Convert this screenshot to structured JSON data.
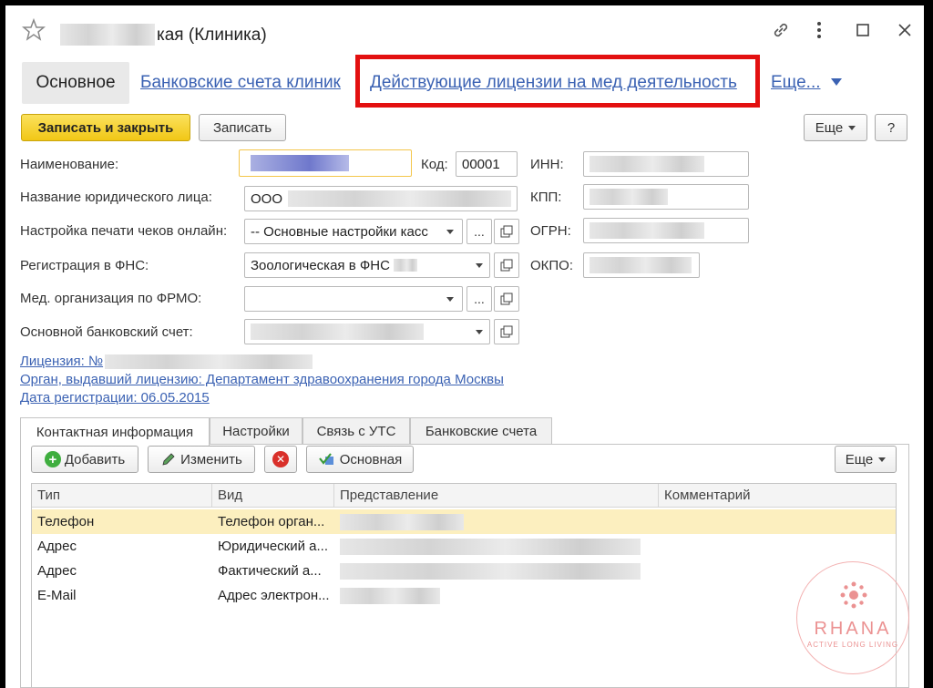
{
  "window": {
    "title_suffix": "кая (Клиника)"
  },
  "nav": {
    "active": "Основное",
    "link1": "Банковские счета клиник",
    "link2": "Действующие лицензии на мед деятельность",
    "more": "Еще..."
  },
  "toolbar": {
    "save_close": "Записать и закрыть",
    "save": "Записать",
    "more": "Еще",
    "help": "?"
  },
  "form": {
    "name_label": "Наименование:",
    "legal_label": "Название юридического лица:",
    "legal_value": "ООО",
    "print_label": "Настройка печати чеков онлайн:",
    "print_value": "-- Основные настройки касс",
    "fns_label": "Регистрация в ФНС:",
    "fns_value": "Зоологическая в ФНС",
    "frmo_label": "Мед. организация по ФРМО:",
    "bank_label": "Основной банковский счет:",
    "code_label": "Код:",
    "code_value": "00001",
    "inn_label": "ИНН:",
    "kpp_label": "КПП:",
    "ogrn_label": "ОГРН:",
    "okpo_label": "ОКПО:",
    "ellipsis": "...",
    "open_icon": "open-icon"
  },
  "license": {
    "line1": "Лицензия: №",
    "line2": "Орган, выдавший лицензию:  Департамент здравоохранения города Москвы",
    "line3": "Дата регистрации: 06.05.2015"
  },
  "tabs": [
    "Контактная информация",
    "Настройки",
    "Связь с УТС",
    "Банковские счета"
  ],
  "contacts_toolbar": {
    "add": "Добавить",
    "edit": "Изменить",
    "main": "Основная",
    "more": "Еще"
  },
  "table": {
    "headers": [
      "Тип",
      "Вид",
      "Представление",
      "Комментарий"
    ],
    "rows": [
      {
        "type": "Телефон",
        "kind": "Телефон орган..."
      },
      {
        "type": "Адрес",
        "kind": "Юридический а..."
      },
      {
        "type": "Адрес",
        "kind": "Фактический а..."
      },
      {
        "type": "E-Mail",
        "kind": "Адрес электрон..."
      }
    ]
  },
  "watermark": {
    "brand": "RHANA",
    "tagline": "ACTIVE LONG LIVING",
    "color": "#e88080"
  },
  "colors": {
    "accent_yellow": "#f1c716",
    "link_blue": "#3b62b3",
    "highlight_red": "#e31010",
    "selected_row": "#fcefbf"
  }
}
